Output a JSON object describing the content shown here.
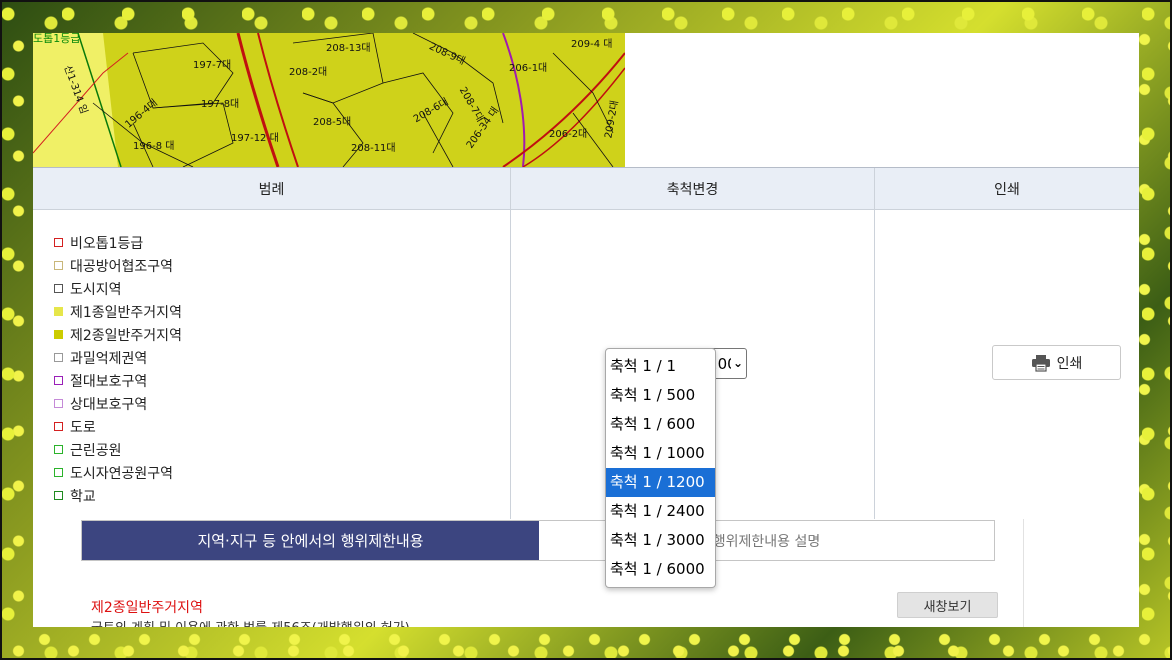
{
  "map": {
    "corner_label": "도톱1등급",
    "parcels": [
      "208-13대",
      "208-9대",
      "209-4 대",
      "197-7대",
      "208-2대",
      "206-1대",
      "197-8대",
      "196-4대",
      "208-7대",
      "208-5대",
      "208-6대",
      "206-2대",
      "209-2대",
      "196-8 대",
      "197-12 대",
      "208-11대",
      "206-34 대",
      "산1-314 임"
    ]
  },
  "legend": {
    "header": "범례",
    "items": [
      {
        "label": "비오톱1등급",
        "color": "#d42020",
        "fill": false
      },
      {
        "label": "대공방어협조구역",
        "color": "#c9b77a",
        "fill": false
      },
      {
        "label": "도시지역",
        "color": "#555555",
        "fill": false
      },
      {
        "label": "제1종일반주거지역",
        "color": "#e6e64a",
        "fill": true
      },
      {
        "label": "제2종일반주거지역",
        "color": "#cccc00",
        "fill": true
      },
      {
        "label": "과밀억제권역",
        "color": "#999999",
        "fill": false
      },
      {
        "label": "절대보호구역",
        "color": "#9a1fb8",
        "fill": false
      },
      {
        "label": "상대보호구역",
        "color": "#c58ad8",
        "fill": false
      },
      {
        "label": "도로",
        "color": "#d42020",
        "fill": false
      },
      {
        "label": "근린공원",
        "color": "#2bb32b",
        "fill": false
      },
      {
        "label": "도시자연공원구역",
        "color": "#2bb32b",
        "fill": false
      },
      {
        "label": "학교",
        "color": "#1f8a1f",
        "fill": false
      }
    ]
  },
  "scale": {
    "header": "축척변경",
    "selected": "축척 1 / 1200",
    "options": [
      "축척 1 / 1",
      "축척 1 / 500",
      "축척 1 / 600",
      "축척 1 / 1000",
      "축척 1 / 1200",
      "축척 1 / 2400",
      "축척 1 / 3000",
      "축척 1 / 6000"
    ],
    "selected_index": 4
  },
  "print": {
    "header": "인쇄",
    "button_label": "인쇄"
  },
  "restrictions": {
    "tab_active": "지역·지구 등 안에서의 행위제한내용",
    "tab_inactive": "행위제한내용 설명",
    "zone_name": "제2종일반주거지역",
    "new_window_label": "새창보기",
    "law_text": "국토의 계획 및 이용에 관한 법률 제56조(개발행위의 허가)"
  },
  "colors": {
    "tab_active_bg": "#3c4580",
    "selected_option_bg": "#1a6fd6",
    "header_bg": "#e9eef6",
    "map_base": "#cfd21a"
  }
}
